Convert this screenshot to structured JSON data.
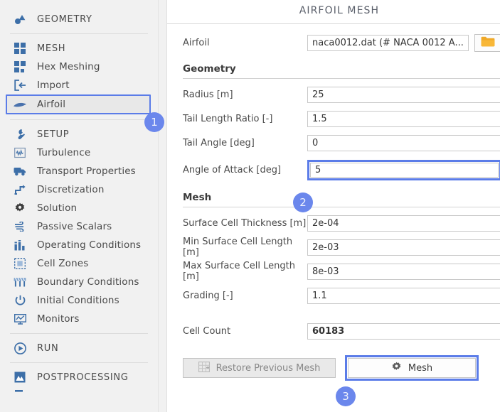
{
  "sidebar": {
    "items": [
      {
        "label": "GEOMETRY",
        "icon": "geometry-icon",
        "type": "section"
      },
      {
        "type": "divider"
      },
      {
        "label": "MESH",
        "icon": "grid-squares-icon",
        "type": "section"
      },
      {
        "label": "Hex Meshing",
        "icon": "hex-mesh-icon",
        "type": "item"
      },
      {
        "label": "Import",
        "icon": "import-icon",
        "type": "item"
      },
      {
        "label": "Airfoil",
        "icon": "airfoil-icon",
        "type": "item",
        "selected": true
      },
      {
        "type": "divider"
      },
      {
        "label": "SETUP",
        "icon": "wrench-icon",
        "type": "section"
      },
      {
        "label": "Turbulence",
        "icon": "turbulence-icon",
        "type": "item"
      },
      {
        "label": "Transport Properties",
        "icon": "truck-icon",
        "type": "item"
      },
      {
        "label": "Discretization",
        "icon": "discretization-icon",
        "type": "item"
      },
      {
        "label": "Solution",
        "icon": "gear-icon",
        "type": "item"
      },
      {
        "label": "Passive Scalars",
        "icon": "wind-icon",
        "type": "item"
      },
      {
        "label": "Operating Conditions",
        "icon": "bar-chart-icon",
        "type": "item"
      },
      {
        "label": "Cell Zones",
        "icon": "cell-zones-icon",
        "type": "item"
      },
      {
        "label": "Boundary Conditions",
        "icon": "boundary-icon",
        "type": "item"
      },
      {
        "label": "Initial Conditions",
        "icon": "power-icon",
        "type": "item"
      },
      {
        "label": "Monitors",
        "icon": "monitor-icon",
        "type": "item"
      },
      {
        "type": "divider"
      },
      {
        "label": "RUN",
        "icon": "play-icon",
        "type": "section"
      },
      {
        "type": "divider"
      },
      {
        "label": "POSTPROCESSING",
        "icon": "postprocessing-icon",
        "type": "section"
      }
    ]
  },
  "panel": {
    "title": "AIRFOIL MESH",
    "airfoil": {
      "label": "Airfoil",
      "value": "naca0012.dat (# NACA 0012 A...",
      "browse_icon": "folder-icon"
    },
    "geometry": {
      "heading": "Geometry",
      "fields": [
        {
          "label": "Radius [m]",
          "value": "25"
        },
        {
          "label": "Tail Length Ratio [-]",
          "value": "1.5"
        },
        {
          "label": "Tail Angle [deg]",
          "value": "0"
        }
      ],
      "focused_field": {
        "label": "Angle of Attack [deg]",
        "value": "5"
      }
    },
    "mesh": {
      "heading": "Mesh",
      "fields": [
        {
          "label": "Surface Cell Thickness [m]",
          "value": "2e-04"
        },
        {
          "label": "Min Surface Cell Length [m]",
          "value": "2e-03"
        },
        {
          "label": "Max Surface Cell Length [m]",
          "value": "8e-03"
        },
        {
          "label": "Grading [-]",
          "value": "1.1"
        }
      ],
      "cell_count": {
        "label": "Cell Count",
        "value": "60183"
      }
    },
    "buttons": {
      "restore": {
        "label": "Restore Previous Mesh",
        "icon": "mesh-grid-icon"
      },
      "mesh": {
        "label": "Mesh",
        "icon": "gear-icon"
      }
    }
  },
  "badges": [
    {
      "id": "badge1",
      "text": "1"
    },
    {
      "id": "badge2",
      "text": "2"
    },
    {
      "id": "badge3",
      "text": "3"
    }
  ],
  "colors": {
    "accent": "#6b87ec",
    "sidebar_bg": "#f1f1f1",
    "icon_blue": "#3d6fa8",
    "folder_orange": "#f0a928"
  }
}
